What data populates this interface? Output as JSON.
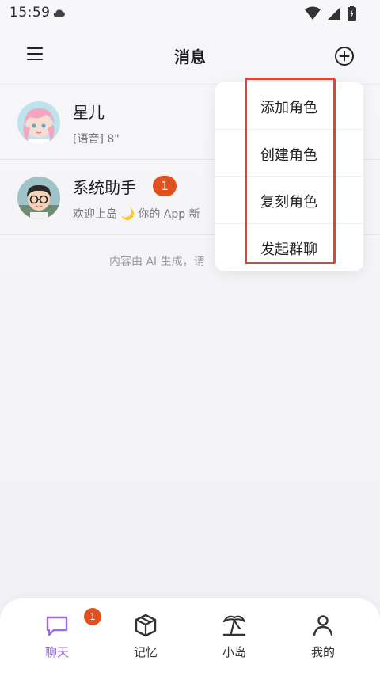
{
  "status_bar": {
    "time": "15:59"
  },
  "header": {
    "title": "消息"
  },
  "chats": [
    {
      "name": "星儿",
      "preview": "[语音] 8\"",
      "unread": ""
    },
    {
      "name": "系统助手",
      "preview": "欢迎上岛 🌙 你的 App 新",
      "unread": "1"
    }
  ],
  "notice": "内容由 AI 生成，请",
  "dropdown": {
    "items": [
      "添加角色",
      "创建角色",
      "复刻角色",
      "发起群聊"
    ]
  },
  "tabs": [
    {
      "label": "聊天",
      "badge": "1",
      "active": true
    },
    {
      "label": "记忆",
      "badge": "",
      "active": false
    },
    {
      "label": "小岛",
      "badge": "",
      "active": false
    },
    {
      "label": "我的",
      "badge": "",
      "active": false
    }
  ],
  "colors": {
    "accent": "#9b6be0",
    "badge": "#e0511f",
    "highlight": "#d9463a"
  }
}
